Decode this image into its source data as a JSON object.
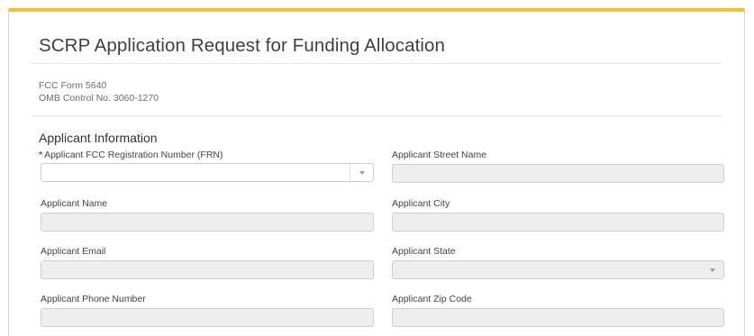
{
  "form": {
    "title": "SCRP Application Request for Funding Allocation",
    "form_number": "FCC Form 5640",
    "omb_control": "OMB Control No. 3060-1270",
    "section_title": "Applicant Information"
  },
  "fields": {
    "frn": {
      "label": "Applicant FCC Registration Number (FRN)",
      "required_marker": "*",
      "value": ""
    },
    "name": {
      "label": "Applicant Name",
      "value": ""
    },
    "email": {
      "label": "Applicant Email",
      "value": ""
    },
    "phone": {
      "label": "Applicant Phone Number",
      "value": ""
    },
    "street": {
      "label": "Applicant Street Name",
      "value": ""
    },
    "city": {
      "label": "Applicant City",
      "value": ""
    },
    "state": {
      "label": "Applicant State",
      "value": ""
    },
    "zip": {
      "label": "Applicant Zip Code",
      "value": ""
    }
  },
  "colors": {
    "accent": "#f2c230",
    "required": "#c0392b",
    "disabled_field": "#eeeeee"
  }
}
